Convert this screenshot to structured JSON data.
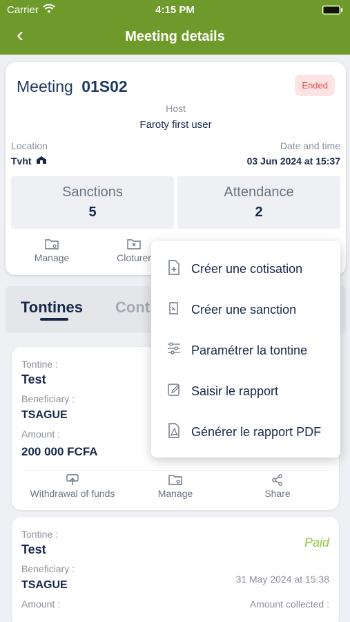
{
  "status_bar": {
    "carrier": "Carrier",
    "time": "4:15 PM"
  },
  "nav": {
    "title": "Meeting details",
    "back_icon": "chevron-left-icon"
  },
  "meeting": {
    "label": "Meeting",
    "code": "01S02",
    "status": "Ended",
    "host_label": "Host",
    "host_name": "Faroty first user",
    "location_label": "Location",
    "location_value": "Tvht",
    "datetime_label": "Date and time",
    "datetime_value": "03 Jun 2024 at 15:37",
    "sanctions_label": "Sanctions",
    "sanctions_count": "5",
    "attendance_label": "Attendance",
    "attendance_count": "2",
    "actions": {
      "manage": "Manage",
      "close": "Cloturer"
    }
  },
  "tabs": {
    "active": "Tontines",
    "inactive": "Cont"
  },
  "tontines": [
    {
      "tontine_label": "Tontine :",
      "tontine_name": "Test",
      "beneficiary_label": "Beneficiary :",
      "beneficiary": "TSAGUE",
      "amount_label": "Amount :",
      "amount": "200 000 FCFA",
      "actions": {
        "withdraw": "Withdrawal of funds",
        "manage": "Manage",
        "share": "Share"
      }
    },
    {
      "tontine_label": "Tontine :",
      "tontine_name": "Test",
      "status": "Paid",
      "beneficiary_label": "Beneficiary :",
      "beneficiary": "TSAGUE",
      "date": "31 May 2024 at 15:38",
      "amount_label": "Amount :",
      "collected_label": "Amount collected :"
    }
  ],
  "menu": {
    "items": [
      {
        "label": "Créer une cotisation",
        "icon": "file-add-icon"
      },
      {
        "label": "Créer une sanction",
        "icon": "sanction-icon"
      },
      {
        "label": "Paramétrer la tontine",
        "icon": "sliders-icon"
      },
      {
        "label": "Saisir le rapport",
        "icon": "edit-report-icon"
      },
      {
        "label": "Générer le rapport PDF",
        "icon": "pdf-icon"
      }
    ]
  },
  "colors": {
    "header": "#6d9a2a",
    "primary": "#16284a",
    "ended": "#e24848",
    "paid": "#8cc43a"
  }
}
